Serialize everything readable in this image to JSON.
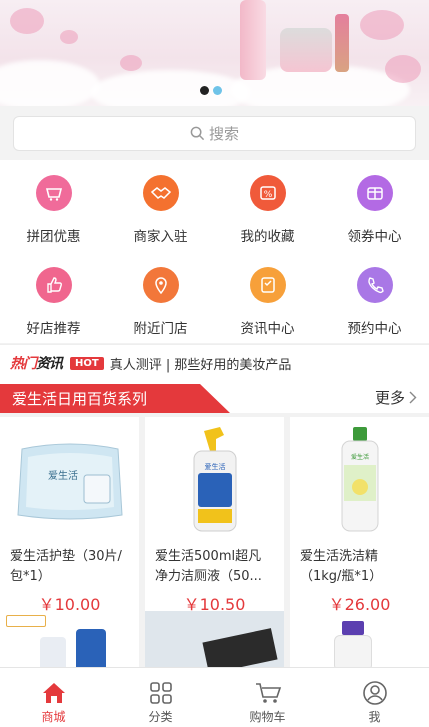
{
  "banner": {
    "slides": 2,
    "active_slide": 1,
    "colors": {
      "dot_active": "#222222",
      "dot_inactive": "#6fc3e8"
    }
  },
  "search": {
    "placeholder": "搜索",
    "icon": "search-icon"
  },
  "categories": [
    {
      "label": "拼团优惠",
      "icon": "group-buy-icon",
      "color": "#f06b9a"
    },
    {
      "label": "商家入驻",
      "icon": "handshake-icon",
      "color": "#f4712f"
    },
    {
      "label": "我的收藏",
      "icon": "favorite-percent-icon",
      "color": "#f05a3a"
    },
    {
      "label": "领券中心",
      "icon": "coupon-icon",
      "color": "#b36ae4"
    },
    {
      "label": "好店推荐",
      "icon": "thumbs-up-icon",
      "color": "#f0668e"
    },
    {
      "label": "附近门店",
      "icon": "location-pin-icon",
      "color": "#f2773a"
    },
    {
      "label": "资讯中心",
      "icon": "news-icon",
      "color": "#f7a03a"
    },
    {
      "label": "预约中心",
      "icon": "phone-icon",
      "color": "#a977e6"
    }
  ],
  "news": {
    "logo_part1": "热门",
    "logo_part2": "资讯",
    "tag": "HOT",
    "text": "真人测评 | 那些好用的美妆产品"
  },
  "section": {
    "title": "爱生活日用百货系列",
    "more_label": "更多"
  },
  "products": [
    {
      "name": "爱生活护垫（30片/包*1）",
      "price": "￥10.00"
    },
    {
      "name": "爱生活500ml超凡净力洁厕液（50...",
      "price": "￥10.50"
    },
    {
      "name": "爱生活洗洁精（1kg/瓶*1）",
      "price": "￥26.00"
    }
  ],
  "tabbar": [
    {
      "label": "商城",
      "icon": "home-icon",
      "active": true
    },
    {
      "label": "分类",
      "icon": "grid-icon",
      "active": false
    },
    {
      "label": "购物车",
      "icon": "cart-icon",
      "active": false
    },
    {
      "label": "我",
      "icon": "user-icon",
      "active": false
    }
  ],
  "colors": {
    "accent": "#e4393c"
  }
}
